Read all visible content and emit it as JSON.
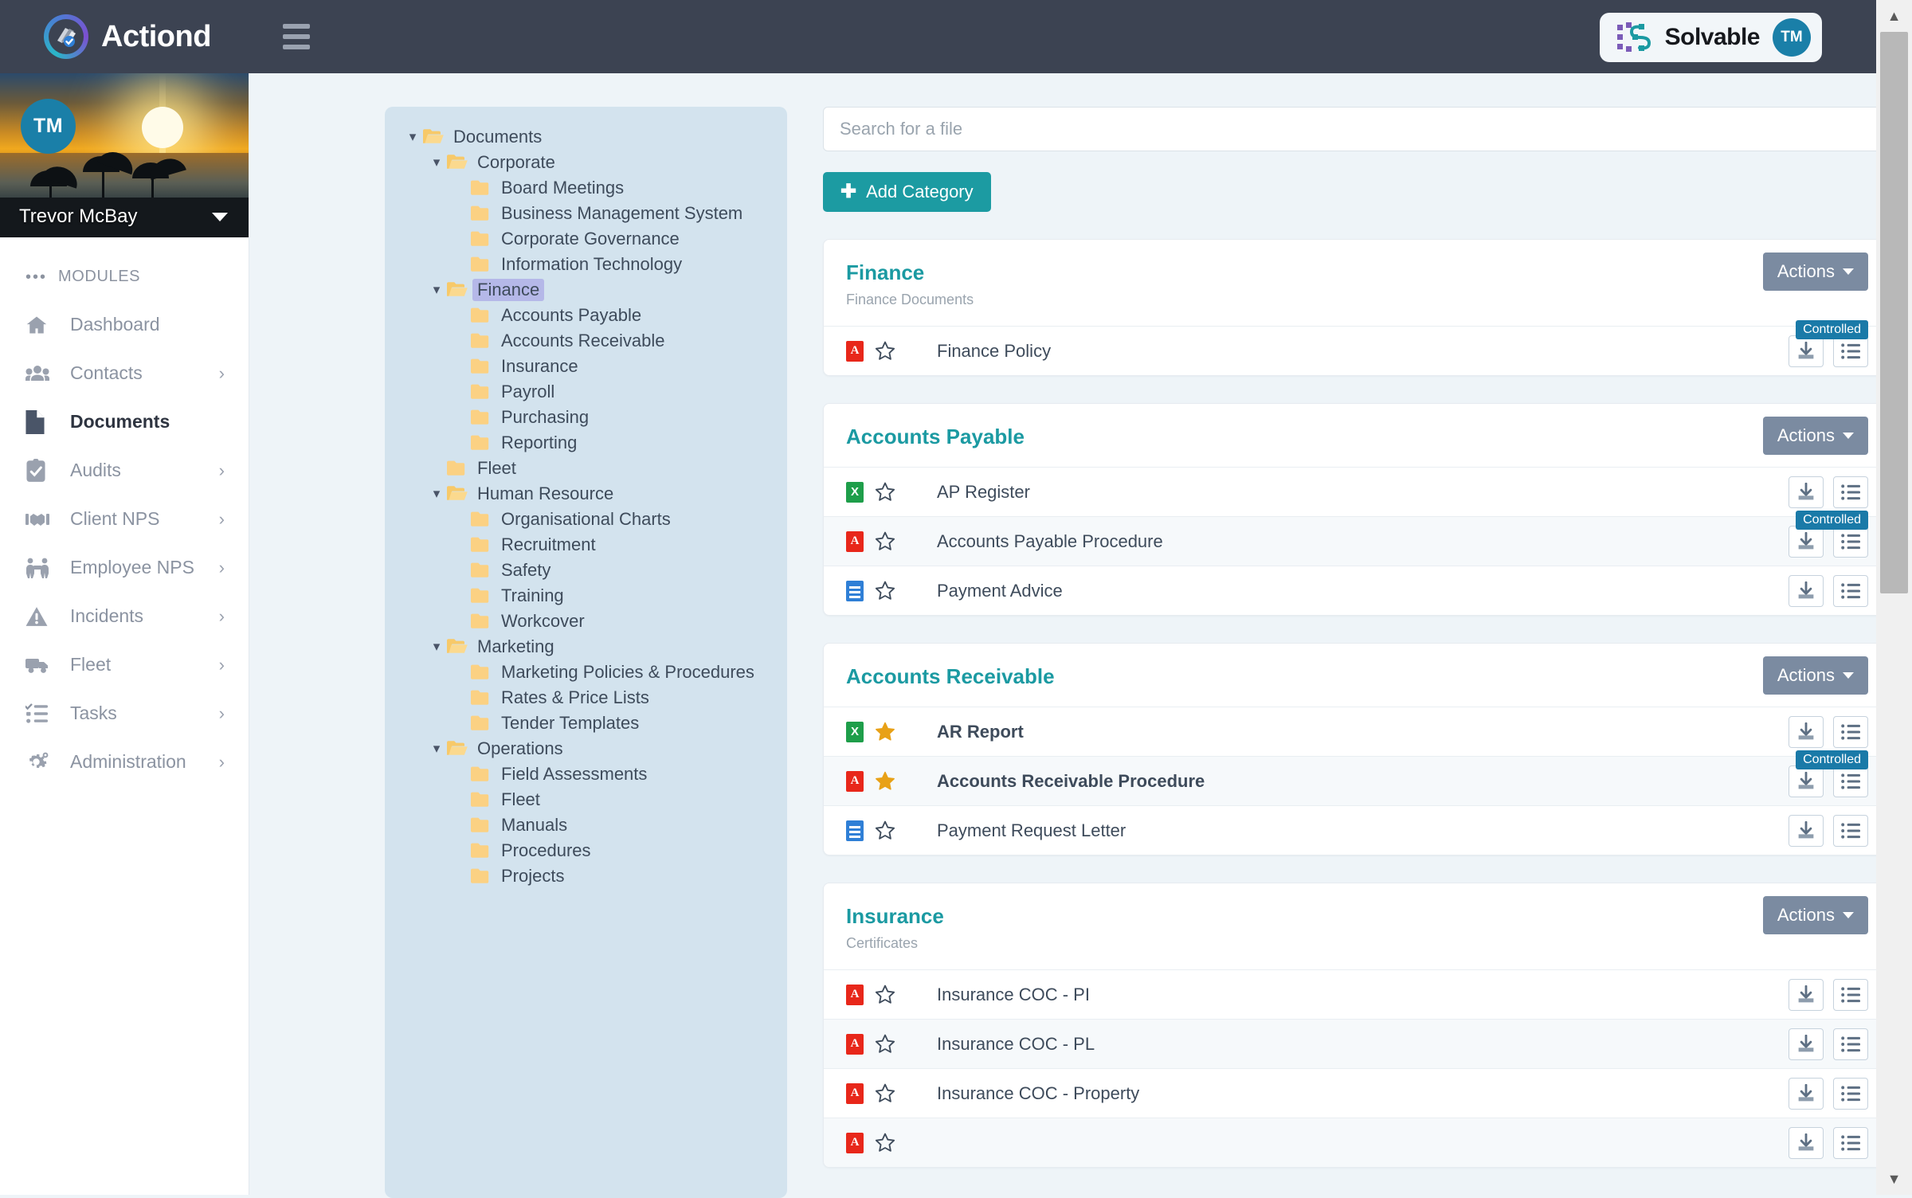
{
  "topbar": {
    "brand_name": "Actiond",
    "menu_icon": "hamburger-icon",
    "partner_name": "Solvable",
    "partner_initials": "TM"
  },
  "sidebar": {
    "profile": {
      "initials": "TM",
      "name": "Trevor McBay"
    },
    "section_label": "MODULES",
    "items": [
      {
        "label": "Dashboard",
        "icon": "home-icon",
        "active": false,
        "chevron": false
      },
      {
        "label": "Contacts",
        "icon": "people-icon",
        "active": false,
        "chevron": true
      },
      {
        "label": "Documents",
        "icon": "document-icon",
        "active": true,
        "chevron": false
      },
      {
        "label": "Audits",
        "icon": "clipboard-check-icon",
        "active": false,
        "chevron": true
      },
      {
        "label": "Client NPS",
        "icon": "handshake-icon",
        "active": false,
        "chevron": true
      },
      {
        "label": "Employee NPS",
        "icon": "teamwork-icon",
        "active": false,
        "chevron": true
      },
      {
        "label": "Incidents",
        "icon": "warning-icon",
        "active": false,
        "chevron": true
      },
      {
        "label": "Fleet",
        "icon": "truck-icon",
        "active": false,
        "chevron": true
      },
      {
        "label": "Tasks",
        "icon": "checklist-icon",
        "active": false,
        "chevron": true
      },
      {
        "label": "Administration",
        "icon": "gears-icon",
        "active": false,
        "chevron": true
      }
    ]
  },
  "tree": [
    {
      "label": "Documents",
      "indent": 0,
      "open": true,
      "selected": false
    },
    {
      "label": "Corporate",
      "indent": 1,
      "open": true,
      "selected": false
    },
    {
      "label": "Board Meetings",
      "indent": 2,
      "open": null,
      "selected": false
    },
    {
      "label": "Business Management System",
      "indent": 2,
      "open": null,
      "selected": false
    },
    {
      "label": "Corporate Governance",
      "indent": 2,
      "open": null,
      "selected": false
    },
    {
      "label": "Information Technology",
      "indent": 2,
      "open": null,
      "selected": false
    },
    {
      "label": "Finance",
      "indent": 1,
      "open": true,
      "selected": true
    },
    {
      "label": "Accounts Payable",
      "indent": 2,
      "open": null,
      "selected": false
    },
    {
      "label": "Accounts Receivable",
      "indent": 2,
      "open": null,
      "selected": false
    },
    {
      "label": "Insurance",
      "indent": 2,
      "open": null,
      "selected": false
    },
    {
      "label": "Payroll",
      "indent": 2,
      "open": null,
      "selected": false
    },
    {
      "label": "Purchasing",
      "indent": 2,
      "open": null,
      "selected": false
    },
    {
      "label": "Reporting",
      "indent": 2,
      "open": null,
      "selected": false
    },
    {
      "label": "Fleet",
      "indent": 1,
      "open": null,
      "selected": false
    },
    {
      "label": "Human Resource",
      "indent": 1,
      "open": true,
      "selected": false
    },
    {
      "label": "Organisational Charts",
      "indent": 2,
      "open": null,
      "selected": false
    },
    {
      "label": "Recruitment",
      "indent": 2,
      "open": null,
      "selected": false
    },
    {
      "label": "Safety",
      "indent": 2,
      "open": null,
      "selected": false
    },
    {
      "label": "Training",
      "indent": 2,
      "open": null,
      "selected": false
    },
    {
      "label": "Workcover",
      "indent": 2,
      "open": null,
      "selected": false
    },
    {
      "label": "Marketing",
      "indent": 1,
      "open": true,
      "selected": false
    },
    {
      "label": "Marketing Policies & Procedures",
      "indent": 2,
      "open": null,
      "selected": false
    },
    {
      "label": "Rates & Price Lists",
      "indent": 2,
      "open": null,
      "selected": false
    },
    {
      "label": "Tender Templates",
      "indent": 2,
      "open": null,
      "selected": false
    },
    {
      "label": "Operations",
      "indent": 1,
      "open": true,
      "selected": false
    },
    {
      "label": "Field Assessments",
      "indent": 2,
      "open": null,
      "selected": false
    },
    {
      "label": "Fleet",
      "indent": 2,
      "open": null,
      "selected": false
    },
    {
      "label": "Manuals",
      "indent": 2,
      "open": null,
      "selected": false
    },
    {
      "label": "Procedures",
      "indent": 2,
      "open": null,
      "selected": false
    },
    {
      "label": "Projects",
      "indent": 2,
      "open": null,
      "selected": false
    }
  ],
  "main": {
    "search": {
      "value": "",
      "placeholder": "Search for a file"
    },
    "add_category_label": "Add Category",
    "actions_label": "Actions",
    "controlled_badge": "Controlled",
    "categories": [
      {
        "title": "Finance",
        "subtitle": "Finance Documents",
        "files": [
          {
            "name": "Finance Policy",
            "type": "pdf",
            "starred": false,
            "bold": false,
            "controlled": true
          }
        ]
      },
      {
        "title": "Accounts Payable",
        "subtitle": "",
        "files": [
          {
            "name": "AP Register",
            "type": "xls",
            "starred": false,
            "bold": false,
            "controlled": false
          },
          {
            "name": "Accounts Payable Procedure",
            "type": "pdf",
            "starred": false,
            "bold": false,
            "controlled": true
          },
          {
            "name": "Payment Advice",
            "type": "doc",
            "starred": false,
            "bold": false,
            "controlled": false
          }
        ]
      },
      {
        "title": "Accounts Receivable",
        "subtitle": "",
        "files": [
          {
            "name": "AR Report",
            "type": "xls",
            "starred": true,
            "bold": true,
            "controlled": false
          },
          {
            "name": "Accounts Receivable Procedure",
            "type": "pdf",
            "starred": true,
            "bold": true,
            "controlled": true
          },
          {
            "name": "Payment Request Letter",
            "type": "doc",
            "starred": false,
            "bold": false,
            "controlled": false
          }
        ]
      },
      {
        "title": "Insurance",
        "subtitle": "Certificates",
        "files": [
          {
            "name": "Insurance COC - PI",
            "type": "pdf",
            "starred": false,
            "bold": false,
            "controlled": false
          },
          {
            "name": "Insurance COC - PL",
            "type": "pdf",
            "starred": false,
            "bold": false,
            "controlled": false
          },
          {
            "name": "Insurance COC - Property",
            "type": "pdf",
            "starred": false,
            "bold": false,
            "controlled": false
          },
          {
            "name": "",
            "type": "pdf",
            "starred": false,
            "bold": false,
            "controlled": false
          }
        ]
      }
    ]
  },
  "colors": {
    "topbar": "#3c4352",
    "accent_teal": "#1c9ba2",
    "actions_gray": "#7b8ba1",
    "controlled_blue": "#1a7aa8",
    "tree_panel": "#d3e3ee",
    "tree_selected": "#b5b8e8",
    "folder_yellow": "#f9d27d",
    "star_gold": "#e8a117",
    "avatar_blue": "#1a7fa8"
  }
}
